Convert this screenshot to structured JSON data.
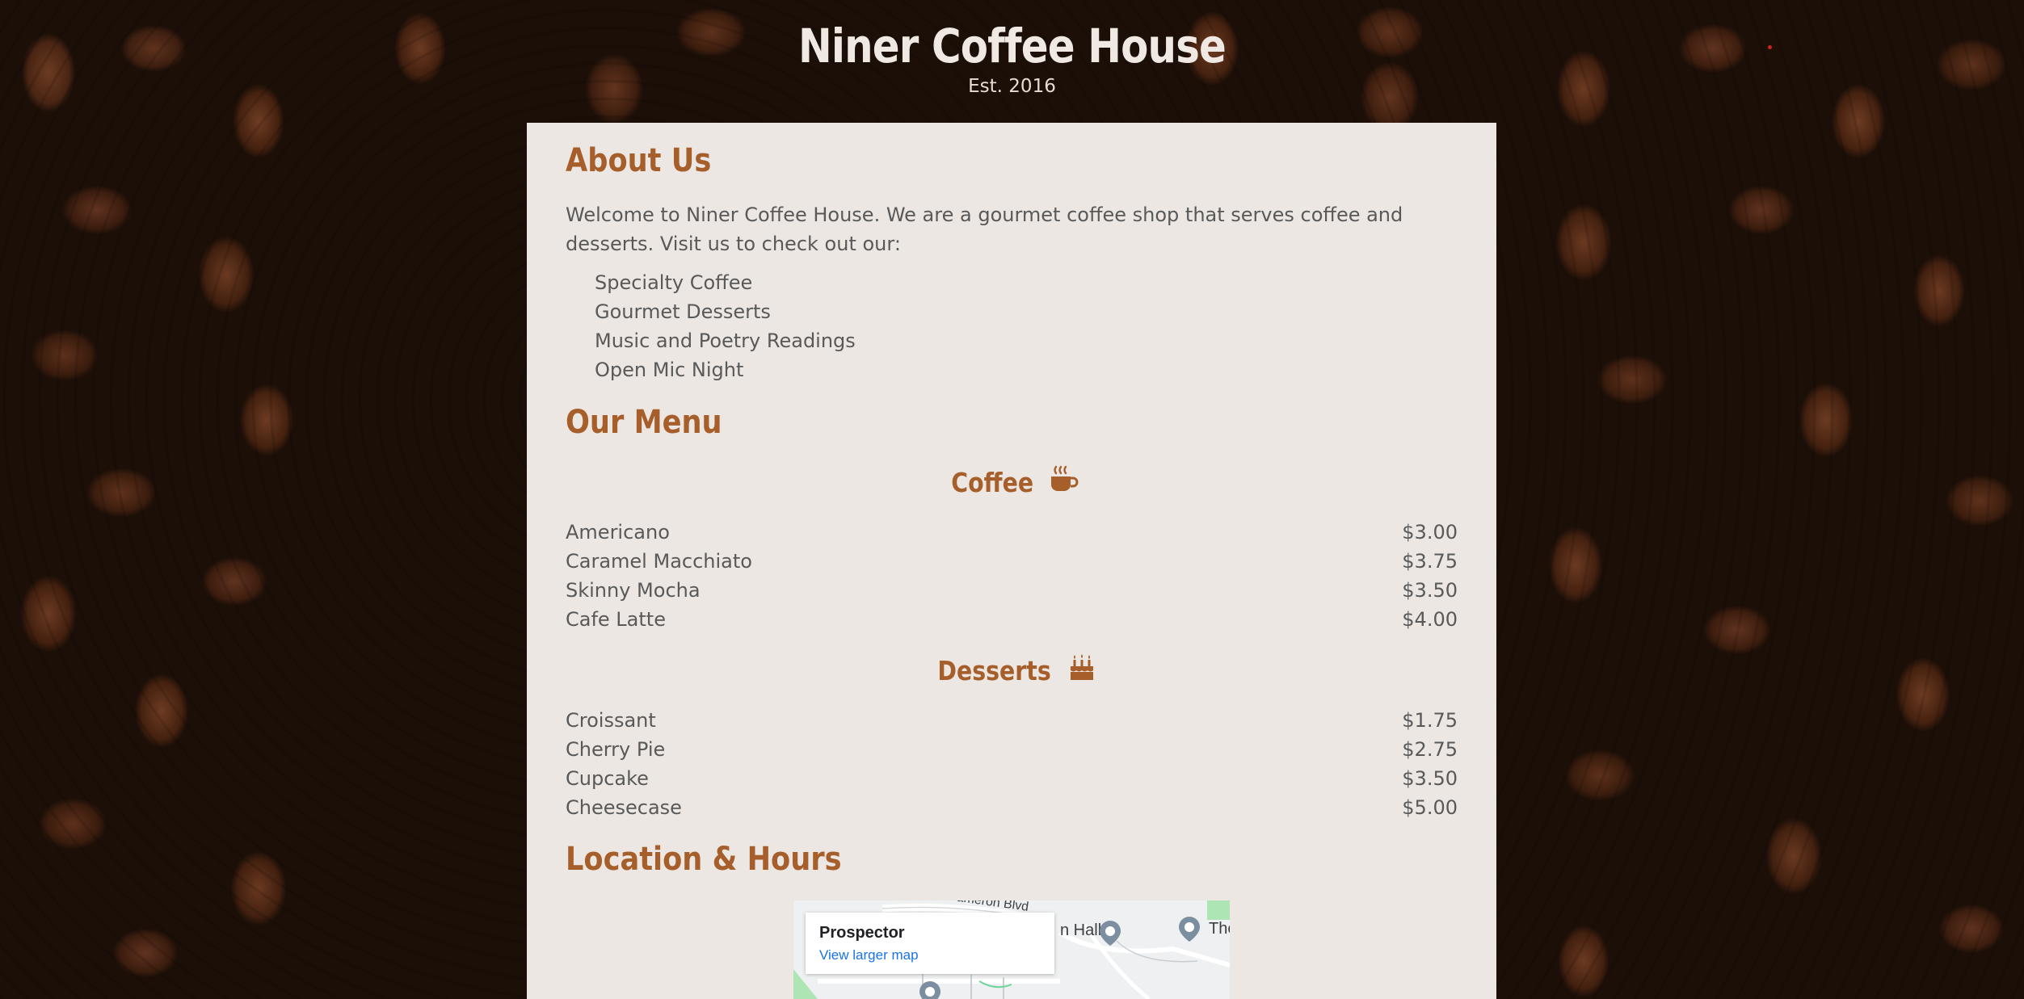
{
  "header": {
    "title": "Niner Coffee House",
    "subtitle": "Est. 2016"
  },
  "about": {
    "heading": "About Us",
    "text": "Welcome to Niner Coffee House. We are a gourmet coffee shop that serves coffee and desserts. Visit us to check out our:",
    "features": [
      "Specialty Coffee",
      "Gourmet Desserts",
      "Music and Poetry Readings",
      "Open Mic Night"
    ]
  },
  "menu": {
    "heading": "Our Menu",
    "coffee": {
      "label": "Coffee",
      "icon": "coffee-cup-icon",
      "items": [
        {
          "name": "Americano",
          "price": "$3.00"
        },
        {
          "name": "Caramel Macchiato",
          "price": "$3.75"
        },
        {
          "name": "Skinny Mocha",
          "price": "$3.50"
        },
        {
          "name": "Cafe Latte",
          "price": "$4.00"
        }
      ]
    },
    "desserts": {
      "label": "Desserts",
      "icon": "birthday-cake-icon",
      "items": [
        {
          "name": "Croissant",
          "price": "$1.75"
        },
        {
          "name": "Cherry Pie",
          "price": "$2.75"
        },
        {
          "name": "Cupcake",
          "price": "$3.50"
        },
        {
          "name": "Cheesecase",
          "price": "$5.00"
        }
      ]
    }
  },
  "location": {
    "heading": "Location & Hours",
    "map": {
      "place_name": "Prospector",
      "link_text": "View larger map",
      "labels": [
        "Cameron Blvd",
        "n Hall",
        "The"
      ]
    }
  },
  "colors": {
    "accent": "#a65e2a",
    "card_bg": "#ece7e3",
    "body_text": "#595959",
    "link": "#1a73e8"
  }
}
